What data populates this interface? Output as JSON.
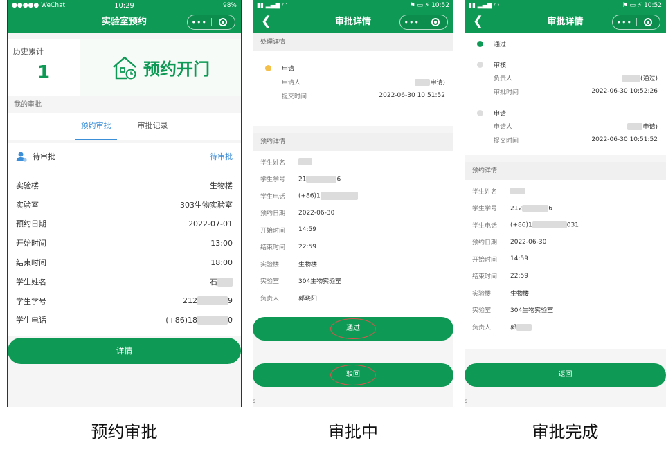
{
  "colors": {
    "brand": "#0e9a55",
    "link": "#3b8ed8",
    "pending_dot": "#f5c04a",
    "ring": "#d9534f"
  },
  "phone1": {
    "status": {
      "carrier": "●●●●● WeChat",
      "time": "10:29",
      "battery": "98%"
    },
    "title": "实验室预约",
    "history_label": "历史累计",
    "history_count": "1",
    "door_label": "预约开门",
    "my_approval_label": "我的审批",
    "tabs": [
      {
        "label": "预约审批"
      },
      {
        "label": "审批记录"
      }
    ],
    "pending_label": "待审批",
    "pending_status": "待审批",
    "rows": [
      {
        "k": "实验楼",
        "v": "生物楼"
      },
      {
        "k": "实验室",
        "v": "303生物实验室"
      },
      {
        "k": "预约日期",
        "v": "2022-07-01"
      },
      {
        "k": "开始时间",
        "v": "13:00"
      },
      {
        "k": "结束时间",
        "v": "18:00"
      },
      {
        "k": "学生姓名",
        "v": "石"
      },
      {
        "k": "学生学号",
        "v": "212"
      },
      {
        "k": "学生电话",
        "v": "(+86)18"
      }
    ],
    "row_tails": [
      "",
      "",
      "",
      "",
      "",
      "",
      "9",
      "0"
    ],
    "detail_button": "详情"
  },
  "phone2": {
    "status": {
      "time": "10:52"
    },
    "title": "审批详情",
    "process_label": "处理详情",
    "apply_title": "申请",
    "applicant_label": "申请人",
    "applicant_value": "申请)",
    "submit_label": "提交时间",
    "submit_value": "2022-06-30 10:51:52",
    "booking_label": "预约详情",
    "rows": [
      {
        "k": "学生姓名",
        "v": ""
      },
      {
        "k": "学生学号",
        "v": "21"
      },
      {
        "k": "学生电话",
        "v": "(+86)1"
      },
      {
        "k": "预约日期",
        "v": "2022-06-30"
      },
      {
        "k": "开始时间",
        "v": "14:59"
      },
      {
        "k": "结束时间",
        "v": "22:59"
      },
      {
        "k": "实验楼",
        "v": "生物楼"
      },
      {
        "k": "实验室",
        "v": "304生物实验室"
      },
      {
        "k": "负责人",
        "v": "郭晓阳"
      }
    ],
    "row_tails": [
      "",
      "6",
      "",
      "",
      "",
      "",
      "",
      "",
      ""
    ],
    "pass_button": "通过",
    "reject_button": "驳回",
    "footer_s": "s"
  },
  "phone3": {
    "status": {
      "time": "10:52"
    },
    "title": "审批详情",
    "pass_title": "通过",
    "review_title": "审核",
    "owner_label": "负责人",
    "owner_value": "(通过)",
    "approve_time_label": "审批时间",
    "approve_time_value": "2022-06-30 10:52:26",
    "apply_title": "申请",
    "applicant_label": "申请人",
    "applicant_value": "申请)",
    "submit_label": "提交时间",
    "submit_value": "2022-06-30 10:51:52",
    "booking_label": "预约详情",
    "rows": [
      {
        "k": "学生姓名",
        "v": ""
      },
      {
        "k": "学生学号",
        "v": "212"
      },
      {
        "k": "学生电话",
        "v": "(+86)1"
      },
      {
        "k": "预约日期",
        "v": "2022-06-30"
      },
      {
        "k": "开始时间",
        "v": "14:59"
      },
      {
        "k": "结束时间",
        "v": "22:59"
      },
      {
        "k": "实验楼",
        "v": "生物楼"
      },
      {
        "k": "实验室",
        "v": "304生物实验室"
      },
      {
        "k": "负责人",
        "v": "郭"
      }
    ],
    "row_tails": [
      "",
      "6",
      "031",
      "",
      "",
      "",
      "",
      "",
      ""
    ],
    "back_button": "返回",
    "footer_s": "s"
  },
  "captions": [
    "预约审批",
    "审批中",
    "审批完成"
  ]
}
